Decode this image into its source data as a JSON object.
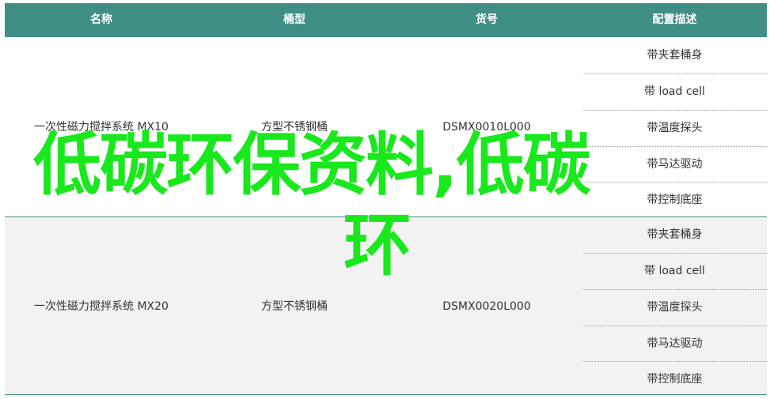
{
  "table": {
    "headers": [
      "名称",
      "桶型",
      "货号",
      "配置描述"
    ],
    "rows": [
      {
        "name": "一次性磁力搅拌系统 MX10",
        "type": "方型不锈钢桶",
        "sku": "DSMX0010L000",
        "config": [
          "带夹套桶身",
          "带 load cell",
          "带温度探头",
          "带马达驱动",
          "带控制底座"
        ]
      },
      {
        "name": "一次性磁力搅拌系统 MX20",
        "type": "方型不锈钢桶",
        "sku": "DSMX0020L000",
        "config": [
          "带夹套桶身",
          "带 load cell",
          "带温度探头",
          "带马达驱动",
          "带控制底座"
        ]
      }
    ]
  },
  "overlay": {
    "line1": "低碳环保资料,低碳",
    "line2": "环"
  },
  "colors": {
    "header_bg": "#3f8f86",
    "overlay_text": "#19e81c",
    "row_alt_bg": "#f2f2f2"
  }
}
